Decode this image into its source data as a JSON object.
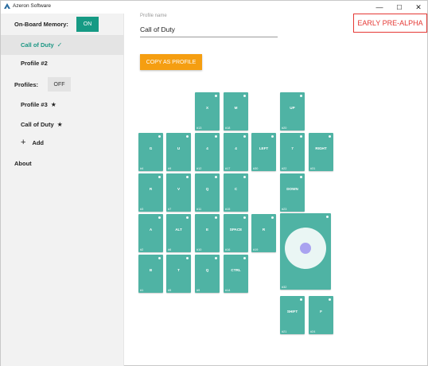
{
  "app": {
    "title": "Azeron Software",
    "logo_icon": "azeron-logo-icon"
  },
  "window_controls": {
    "minimize": "—",
    "maximize": "☐",
    "close": "✕"
  },
  "sidebar": {
    "onboard_label": "On-Board Memory:",
    "onboard_toggle": "ON",
    "onboard_items": [
      {
        "label": "Call of Duty",
        "mark": "✓",
        "active": true
      },
      {
        "label": "Profile #2",
        "mark": ""
      }
    ],
    "profiles_label": "Profiles:",
    "profiles_toggle": "OFF",
    "profile_items": [
      {
        "label": "Profile #3",
        "mark": "★"
      },
      {
        "label": "Call of Duty",
        "mark": "★"
      }
    ],
    "add_icon": "+",
    "add_label": "Add",
    "about_label": "About"
  },
  "main": {
    "profile_name_label": "Profile name",
    "profile_name_value": "Call of Duty",
    "copy_button": "COPY AS PROFILE",
    "badge": "EARLY PRE-ALPHA"
  },
  "keys": [
    {
      "label": "X",
      "num": "#13"
    },
    {
      "label": "M",
      "num": "#18"
    },
    {
      "label": "UP",
      "num": "#20"
    },
    {
      "label": "G",
      "num": "#4"
    },
    {
      "label": "U",
      "num": "#9"
    },
    {
      "label": "4",
      "num": "#12"
    },
    {
      "label": "4",
      "num": "#17"
    },
    {
      "label": "LEFT",
      "num": "#30"
    },
    {
      "label": "7",
      "num": "#22"
    },
    {
      "label": "RIGHT",
      "num": "#31"
    },
    {
      "label": "R",
      "num": "#3"
    },
    {
      "label": "V",
      "num": "#7"
    },
    {
      "label": "Q",
      "num": "#11"
    },
    {
      "label": "C",
      "num": "#15"
    },
    {
      "label": "DOWN",
      "num": "#23"
    },
    {
      "label": "A",
      "num": "#2"
    },
    {
      "label": "ALT",
      "num": "#6"
    },
    {
      "label": "E",
      "num": "#10"
    },
    {
      "label": "SPACE",
      "num": "#16"
    },
    {
      "label": "R",
      "num": "#19"
    },
    {
      "label": "B",
      "num": "#1"
    },
    {
      "label": "T",
      "num": "#5"
    },
    {
      "label": "Q",
      "num": "#9"
    },
    {
      "label": "CTRL",
      "num": "#14"
    },
    {
      "label": "SHIFT",
      "num": "#21"
    },
    {
      "label": "F",
      "num": "#24"
    }
  ],
  "stick": {
    "num": "#32"
  }
}
